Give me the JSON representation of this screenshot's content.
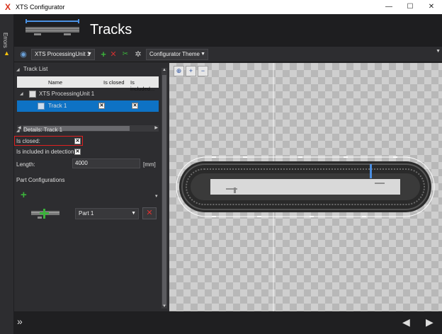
{
  "window": {
    "title": "XTS Configurator",
    "minimize": "—",
    "maximize": "☐",
    "close": "✕"
  },
  "side_tab": {
    "label": "Errors"
  },
  "header": {
    "title": "Tracks"
  },
  "toolbar": {
    "processing_unit": "XTS ProcessingUnit 1",
    "theme": "Configurator Theme",
    "icons": [
      "processing-unit-icon",
      "add-icon",
      "delete-icon",
      "tools-icon",
      "gear-icon"
    ]
  },
  "track_list": {
    "section_label": "Track List",
    "columns": [
      "Name",
      "Is closed",
      "Is included..."
    ],
    "parent_row": "XTS ProcessingUnit 1",
    "rows": [
      {
        "name": "Track 1",
        "is_closed": "✕",
        "is_included": "✕",
        "selected": true
      }
    ]
  },
  "details": {
    "section_label": "Details: Track 1",
    "is_closed_label": "Is closed:",
    "is_closed_value": "✕",
    "is_included_label": "Is included in detection:",
    "is_included_value": "✕",
    "length_label": "Length:",
    "length_value": "4000",
    "length_unit": "[mm]",
    "part_config_label": "Part Configurations",
    "part_value": "Part 1"
  },
  "colors": {
    "accent": "#0e72c4",
    "highlight_red": "#e02020",
    "add_green": "#3bb33b"
  }
}
